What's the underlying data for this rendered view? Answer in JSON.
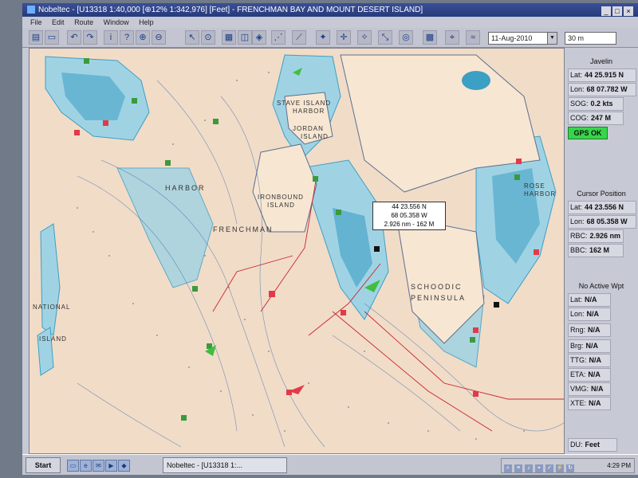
{
  "window": {
    "title": "Nobeltec - [U13318 1:40,000 [⊕12% 1:342,976] [Feet] - FRENCHMAN BAY AND MOUNT DESERT ISLAND]",
    "controls": [
      "_",
      "□",
      "×"
    ]
  },
  "menu": [
    "File",
    "Edit",
    "Route",
    "Window",
    "Help"
  ],
  "toolbar": {
    "date": "11-Aug-2010",
    "scale": "30 m"
  },
  "chart_labels": {
    "harbor_top": "STAVE ISLAND",
    "harbor_top2": "HARBOR",
    "jordan": "JORDAN",
    "jordan2": "ISLAND",
    "ironbound": "IRONBOUND",
    "ironbound2": "ISLAND",
    "frenchman": "FRENCHMAN",
    "harbor_left": "HARBOR",
    "schoodic": "SCHOODIC",
    "peninsula": "PENINSULA",
    "rose": "ROSE",
    "harbor_right": "HARBOR",
    "national": "NATIONAL",
    "island_left": "ISLAND"
  },
  "cursor_popup": {
    "lat": "44 23.556 N",
    "lon": "68 05.358 W",
    "range": "2.926 nm - 162 M"
  },
  "vessel": {
    "heading": "Javelin",
    "lat_label": "Lat:",
    "lat": "44 25.915 N",
    "lon_label": "Lon:",
    "lon": "68 07.782 W",
    "sog_label": "SOG:",
    "sog": "0.2 kts",
    "cog_label": "COG:",
    "cog": "247 M",
    "gps_status": "GPS OK"
  },
  "cursor_position": {
    "heading": "Cursor Position",
    "lat_label": "Lat:",
    "lat": "44 23.556 N",
    "lon_label": "Lon:",
    "lon": "68 05.358 W",
    "rbc_label": "RBC:",
    "rbc": "2.926 nm",
    "bbc_label": "BBC:",
    "bbc": "162 M"
  },
  "waypoint": {
    "heading": "No Active Wpt",
    "lat_label": "Lat:",
    "lat": "N/A",
    "lon_label": "Lon:",
    "lon": "N/A",
    "rng_label": "Rng:",
    "rng": "N/A",
    "brg_label": "Brg:",
    "brg": "N/A",
    "ttg_label": "TTG:",
    "ttg": "N/A",
    "eta_label": "ETA:",
    "eta": "N/A",
    "vmg_label": "VMG:",
    "vmg": "N/A",
    "xte_label": "XTE:",
    "xte": "N/A"
  },
  "units": {
    "du_label": "DU:",
    "du": "Feet"
  },
  "taskbar": {
    "start": "Start",
    "task": "Nobeltec - [U13318 1:...",
    "clock": "4:29 PM"
  },
  "colors": {
    "land": "#f1dcc8",
    "water_shallow": "#9fd3e4",
    "water_deep": "#3c9fc4",
    "marker_red": "#e23a4a",
    "marker_green": "#3b9a3e",
    "route": "#c8242c"
  },
  "icons": [
    "zoom-in-icon",
    "zoom-out-icon",
    "pan-icon",
    "route-icon",
    "grid-icon",
    "gps-icon"
  ]
}
